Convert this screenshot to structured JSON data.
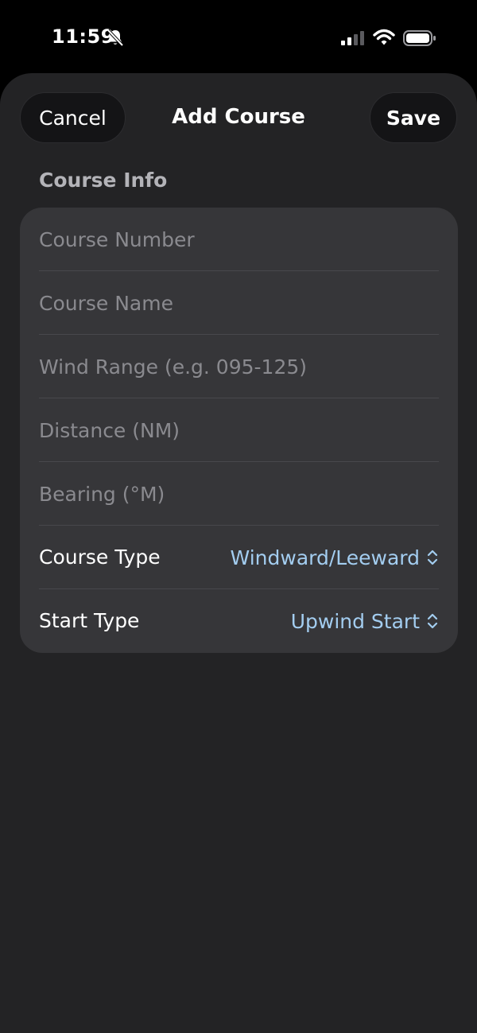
{
  "status_bar": {
    "time": "11:59"
  },
  "nav": {
    "cancel_label": "Cancel",
    "title": "Add Course",
    "save_label": "Save"
  },
  "section": {
    "header": "Course Info"
  },
  "fields": [
    {
      "placeholder": "Course Number",
      "value": ""
    },
    {
      "placeholder": "Course Name",
      "value": ""
    },
    {
      "placeholder": "Wind Range (e.g. 095-125)",
      "value": ""
    },
    {
      "placeholder": "Distance (NM)",
      "value": ""
    },
    {
      "placeholder": "Bearing (°M)",
      "value": ""
    }
  ],
  "pickers": [
    {
      "label": "Course Type",
      "value": "Windward/Leeward"
    },
    {
      "label": "Start Type",
      "value": "Upwind Start"
    }
  ],
  "colors": {
    "accent": "#a3cdf0",
    "sheet_bg": "#232325",
    "card_bg": "#363639"
  }
}
